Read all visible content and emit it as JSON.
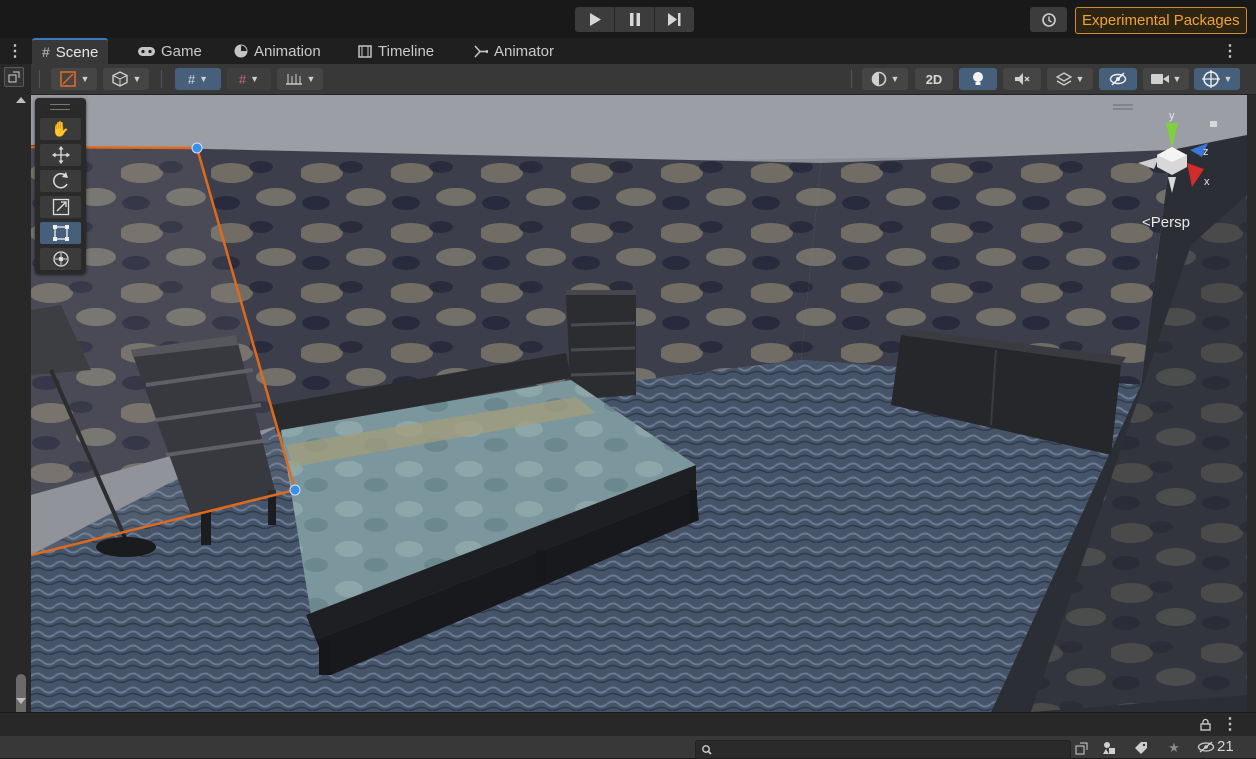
{
  "topbar": {
    "play_icon": "play-icon",
    "pause_icon": "pause-icon",
    "step_icon": "step-icon",
    "history_icon": "history-icon",
    "experimental_label": "Experimental Packages",
    "accent_color": "#d0892c"
  },
  "tabs": [
    {
      "label": "Scene",
      "icon": "hash-icon",
      "active": true
    },
    {
      "label": "Game",
      "icon": "gamepad-icon",
      "active": false
    },
    {
      "label": "Animation",
      "icon": "clock-icon",
      "active": false
    },
    {
      "label": "Timeline",
      "icon": "film-icon",
      "active": false
    },
    {
      "label": "Animator",
      "icon": "animator-icon",
      "active": false
    }
  ],
  "scene_toolbar": {
    "toggle_2d_label": "2D",
    "left_tools": [
      "gizmo-tool-icon",
      "cube-icon",
      "grid-snap-icon",
      "increment-snap-icon",
      "ruler-icon"
    ],
    "right_tools": [
      "shading-icon",
      "light-icon",
      "audio-mute-icon",
      "effects-icon",
      "hidden-icon",
      "camera-icon",
      "gizmos-icon"
    ]
  },
  "tool_palette": [
    "hand-tool-icon",
    "move-tool-icon",
    "rotate-tool-icon",
    "scale-tool-icon",
    "rect-tool-icon",
    "transform-tool-icon"
  ],
  "gizmo": {
    "projection_label": "Persp",
    "axis_y": "y",
    "axis_z": "z",
    "axis_x": "x"
  },
  "bottom": {
    "search_placeholder": "",
    "hidden_count": "21"
  },
  "colors": {
    "selection_outline": "#e06a1c",
    "active_blue": "#46607c",
    "tab_accent": "#3a79bb"
  }
}
